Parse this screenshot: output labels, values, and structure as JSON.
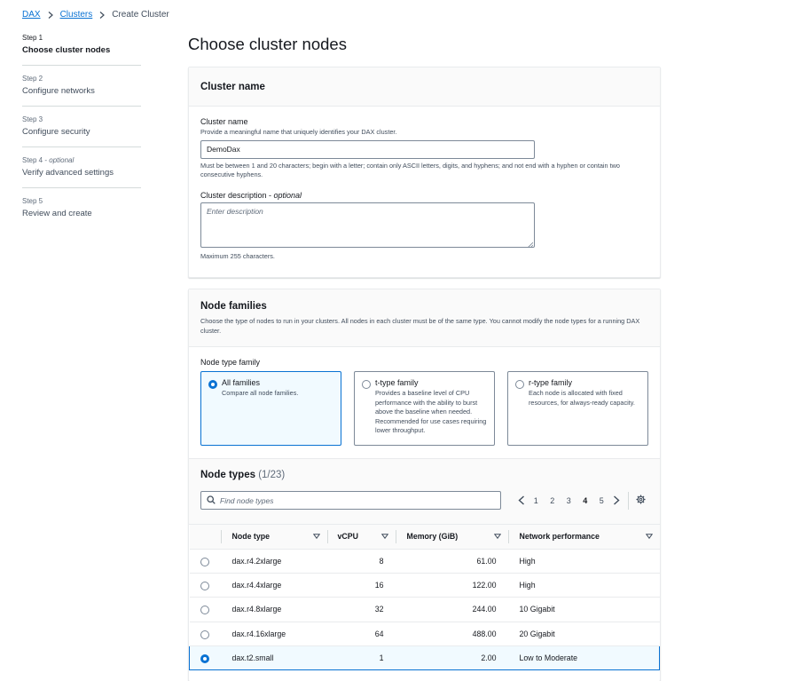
{
  "breadcrumb": {
    "root": "DAX",
    "clusters": "Clusters",
    "current": "Create Cluster"
  },
  "steps": [
    {
      "num": "Step 1",
      "optional": "",
      "name": "Choose cluster nodes",
      "active": true
    },
    {
      "num": "Step 2",
      "optional": "",
      "name": "Configure networks",
      "active": false
    },
    {
      "num": "Step 3",
      "optional": "",
      "name": "Configure security",
      "active": false
    },
    {
      "num": "Step 4 - ",
      "optional": "optional",
      "name": "Verify advanced settings",
      "active": false
    },
    {
      "num": "Step 5",
      "optional": "",
      "name": "Review and create",
      "active": false
    }
  ],
  "page_title": "Choose cluster nodes",
  "cluster_name": {
    "heading": "Cluster name",
    "label": "Cluster name",
    "description": "Provide a meaningful name that uniquely identifies your DAX cluster.",
    "value": "DemoDax",
    "constraint": "Must be between 1 and 20 characters; begin with a letter; contain only ASCII letters, digits, and hyphens; and not end with a hyphen or contain two consecutive hyphens.",
    "desc_label": "Cluster description - ",
    "desc_optional": "optional",
    "desc_placeholder": "Enter description",
    "desc_constraint": "Maximum 255 characters."
  },
  "node_families": {
    "heading": "Node families",
    "description": "Choose the type of nodes to run in your clusters. All nodes in each cluster must be of the same type. You cannot modify the node types for a running DAX cluster.",
    "label": "Node type family",
    "options": [
      {
        "title": "All families",
        "desc": "Compare all node families.",
        "selected": true
      },
      {
        "title": "t-type family",
        "desc": "Provides a baseline level of CPU performance with the ability to burst above the baseline when needed. Recommended for use cases requiring lower throughput.",
        "selected": false
      },
      {
        "title": "r-type family",
        "desc": "Each node is allocated with fixed resources, for always-ready capacity.",
        "selected": false
      }
    ]
  },
  "node_types": {
    "heading": "Node types",
    "count": "(1/23)",
    "search_placeholder": "Find node types",
    "pages": [
      "1",
      "2",
      "3",
      "4",
      "5"
    ],
    "current_page": "4",
    "columns": [
      "Node type",
      "vCPU",
      "Memory (GiB)",
      "Network performance"
    ],
    "rows": [
      {
        "type": "dax.r4.2xlarge",
        "vcpu": "8",
        "memory": "61.00",
        "network": "High",
        "selected": false
      },
      {
        "type": "dax.r4.4xlarge",
        "vcpu": "16",
        "memory": "122.00",
        "network": "High",
        "selected": false
      },
      {
        "type": "dax.r4.8xlarge",
        "vcpu": "32",
        "memory": "244.00",
        "network": "10 Gigabit",
        "selected": false
      },
      {
        "type": "dax.r4.16xlarge",
        "vcpu": "64",
        "memory": "488.00",
        "network": "20 Gigabit",
        "selected": false
      },
      {
        "type": "dax.t2.small",
        "vcpu": "1",
        "memory": "2.00",
        "network": "Low to Moderate",
        "selected": true
      }
    ]
  },
  "colors": {
    "link": "#0972d3",
    "selected_bg": "#f1faff",
    "border": "#7d8998"
  }
}
